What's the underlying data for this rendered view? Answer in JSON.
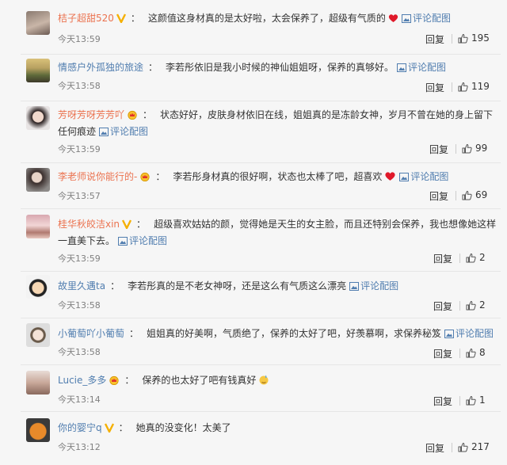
{
  "reply_label": "回复",
  "pic_label": "评论配图",
  "comments": [
    {
      "user": "桔子超甜520",
      "text": "这颜值这身材真的是太好啦，太会保养了，超级有气质的",
      "time": "今天13:59",
      "likes": "195"
    },
    {
      "user": "情感户外孤独的旅途",
      "text": "李若彤依旧是我小时候的神仙姐姐呀，保养的真够好。",
      "time": "今天13:58",
      "likes": "119"
    },
    {
      "user": "芳呀芳呀芳芳吖",
      "text": "状态好好，皮肤身材依旧在线，姐姐真的是冻龄女神，岁月不曾在她的身上留下任何痕迹",
      "time": "今天13:59",
      "likes": "99"
    },
    {
      "user": "李老师说你能行的-",
      "text": "李若彤身材真的很好啊，状态也太棒了吧，超喜欢",
      "time": "今天13:57",
      "likes": "69"
    },
    {
      "user": "桂华秋皎洁xin",
      "text": "超级喜欢姑姑的颜，觉得她是天生的女主脸，而且还特别会保养，我也想像她这样一直美下去。",
      "time": "今天13:59",
      "likes": "2"
    },
    {
      "user": "故里久遇ta",
      "text": "李若彤真的是不老女神呀，还是这么有气质这么漂亮",
      "time": "今天13:58",
      "likes": "2"
    },
    {
      "user": "小葡萄吖小葡萄",
      "text": "姐姐真的好美啊，气质绝了，保养的太好了吧，好羡慕啊，求保养秘笈",
      "time": "今天13:58",
      "likes": "8"
    },
    {
      "user": "Lucie_多多",
      "text": "保养的也太好了吧有钱真好",
      "time": "今天13:14",
      "likes": "1"
    },
    {
      "user": "你的婴宁q",
      "text": "她真的没变化！太美了",
      "time": "今天13:12",
      "likes": "217"
    }
  ]
}
